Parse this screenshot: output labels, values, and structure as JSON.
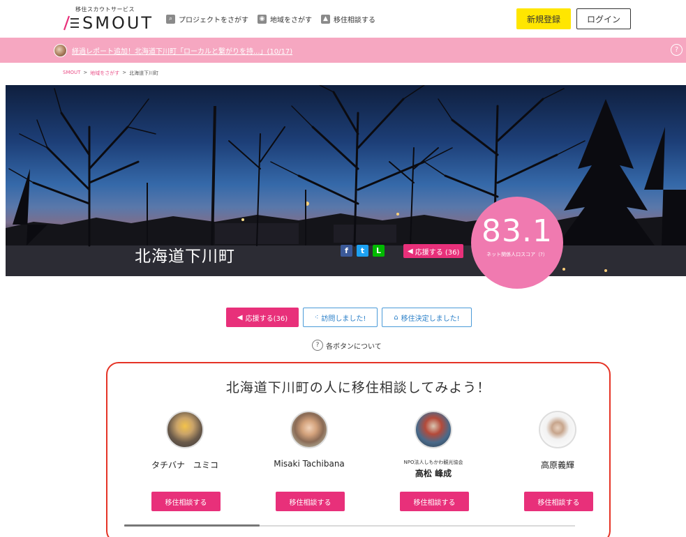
{
  "header": {
    "logo_sub": "移住スカウトサービス",
    "logo_text": "SMOUT",
    "nav": [
      {
        "label": "プロジェクトをさがす",
        "icon": "search-icon"
      },
      {
        "label": "地域をさがす",
        "icon": "map-pin-icon"
      },
      {
        "label": "移住相談する",
        "icon": "person-icon"
      }
    ],
    "register_label": "新規登録",
    "login_label": "ログイン"
  },
  "notice": {
    "text": "経過レポート追加！北海道下川町「ローカルと繋がりを持...」(10/17)",
    "help": "?"
  },
  "breadcrumb": {
    "home": "SMOUT",
    "sep": ">",
    "region_search": "地域をさがす",
    "current": "北海道下川町"
  },
  "hero": {
    "title": "北海道下川町",
    "support_label": "応援する (36)",
    "share": [
      {
        "name": "facebook",
        "glyph": "f",
        "color": "#3b5998"
      },
      {
        "name": "twitter",
        "glyph": "t",
        "color": "#1da1f2"
      },
      {
        "name": "line",
        "glyph": "L",
        "color": "#00b900"
      }
    ]
  },
  "score": {
    "value": "83.1",
    "label": "ネット関係人口スコア（?）"
  },
  "actions": {
    "support_label": "応援する(36)",
    "visit_label": "訪問しました!",
    "move_label": "移住決定しました!",
    "about_label": "各ボタンについて",
    "about_q": "?"
  },
  "consult": {
    "title": "北海道下川町の人に移住相談してみよう！",
    "button_label": "移住相談する",
    "people": [
      {
        "org": "",
        "name": "タチバナ　ユミコ"
      },
      {
        "org": "",
        "name": "Misaki Tachibana"
      },
      {
        "org": "NPO法人しもかわ観光協会",
        "name": "高松 峰成"
      },
      {
        "org": "",
        "name": "高原義輝"
      }
    ],
    "scroll_fraction": 0.3
  },
  "colors": {
    "accent_pink": "#e8307a",
    "notice_pink": "#f6a7c1",
    "score_pink": "#f07ab0",
    "register_yellow": "#ffe600",
    "panel_border": "#e53325",
    "outline_blue": "#4a9ad8"
  }
}
